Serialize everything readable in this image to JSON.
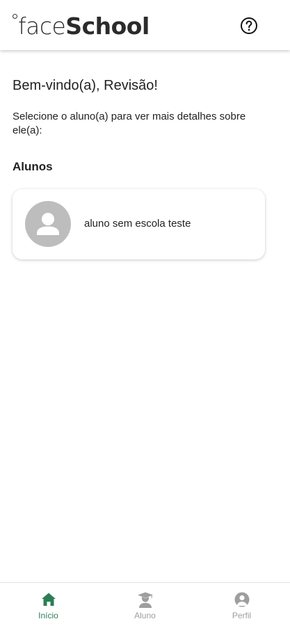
{
  "header": {
    "logo_part1": "face",
    "logo_part2": "School"
  },
  "main": {
    "welcome": "Bem-vindo(a), Revisão!",
    "instructions": "Selecione o aluno(a) para ver mais detalhes sobre ele(a):",
    "section_title": "Alunos",
    "students": [
      {
        "name": "aluno sem escola teste"
      }
    ]
  },
  "nav": {
    "items": [
      {
        "label": "Início",
        "icon": "home-icon",
        "active": true
      },
      {
        "label": "Aluno",
        "icon": "graduate-icon",
        "active": false
      },
      {
        "label": "Perfil",
        "icon": "account-circle-icon",
        "active": false
      }
    ]
  },
  "colors": {
    "accent": "#2e7d57",
    "inactive": "#9e9e9e",
    "avatar_bg": "#bdbdbd"
  }
}
